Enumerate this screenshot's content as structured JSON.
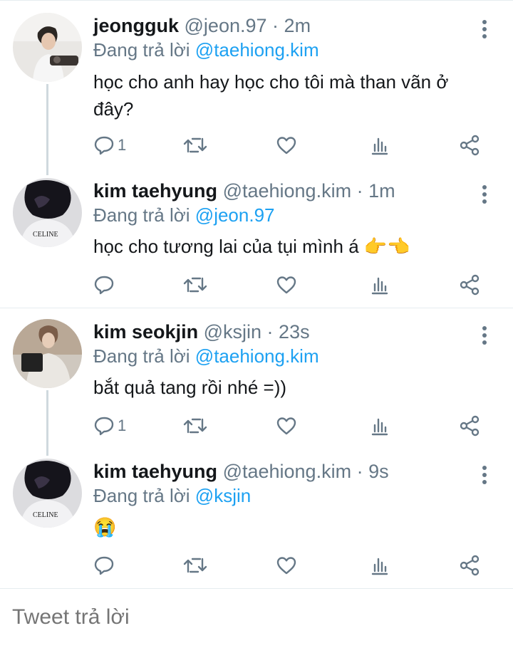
{
  "reply_prefix": "Đang trả lời",
  "tweets": [
    {
      "name": "jeongguk",
      "handle": "@jeon.97",
      "time": "2m",
      "reply_to": "@taehiong.kim",
      "text": "học cho anh hay học cho tôi mà than vãn ở đây?",
      "reply_count": "1"
    },
    {
      "name": "kim taehyung",
      "handle": "@taehiong.kim",
      "time": "1m",
      "reply_to": "@jeon.97",
      "text": "học cho tương lai của tụi mình á 👉👈",
      "reply_count": ""
    },
    {
      "name": "kim seokjin",
      "handle": "@ksjin",
      "time": "23s",
      "reply_to": "@taehiong.kim",
      "text": "bắt quả tang rồi nhé =))",
      "reply_count": "1"
    },
    {
      "name": "kim taehyung",
      "handle": "@taehiong.kim",
      "time": "9s",
      "reply_to": "@ksjin",
      "text": "😭",
      "reply_count": ""
    }
  ],
  "compose": {
    "placeholder": "Tweet trả lời"
  },
  "icons": [
    "reply-icon",
    "retweet-icon",
    "like-icon",
    "analytics-icon",
    "share-icon",
    "more-icon"
  ],
  "colors": {
    "mention": "#1da1f2",
    "secondary": "#657786",
    "divider": "#e6ecf0"
  }
}
